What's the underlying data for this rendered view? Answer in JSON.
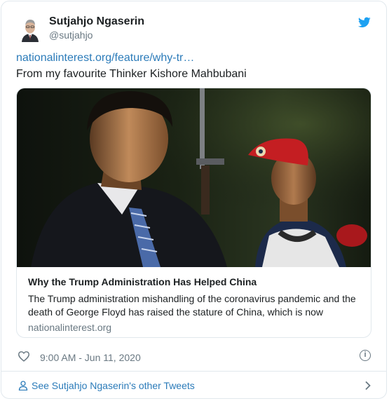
{
  "author": {
    "name": "Sutjahjo Ngaserin",
    "handle": "@sutjahjo",
    "avatar_icon": "avatar-photo"
  },
  "brand": {
    "icon": "twitter-bird-icon",
    "color": "#1da1f2"
  },
  "tweet": {
    "link_text": "nationalinterest.org/feature/why-tr…",
    "body": "From my favourite Thinker Kishore Mahbubani"
  },
  "card": {
    "title": "Why the Trump Administration Has Helped China",
    "description": "The Trump administration mishandling of the coronavirus pandemic and the death of George Floyd has raised the stature of China, which is now",
    "domain": "nationalinterest.org"
  },
  "meta": {
    "timestamp": "9:00 AM - Jun 11, 2020",
    "like_icon": "heart-icon",
    "info_icon": "info-icon"
  },
  "footer": {
    "label": "See Sutjahjo Ngaserin's other Tweets",
    "icon": "person-icon",
    "chevron": "chevron-right-icon"
  },
  "colors": {
    "link": "#2b7bb9",
    "secondary_text": "#697882",
    "border": "#e1e8ed"
  }
}
